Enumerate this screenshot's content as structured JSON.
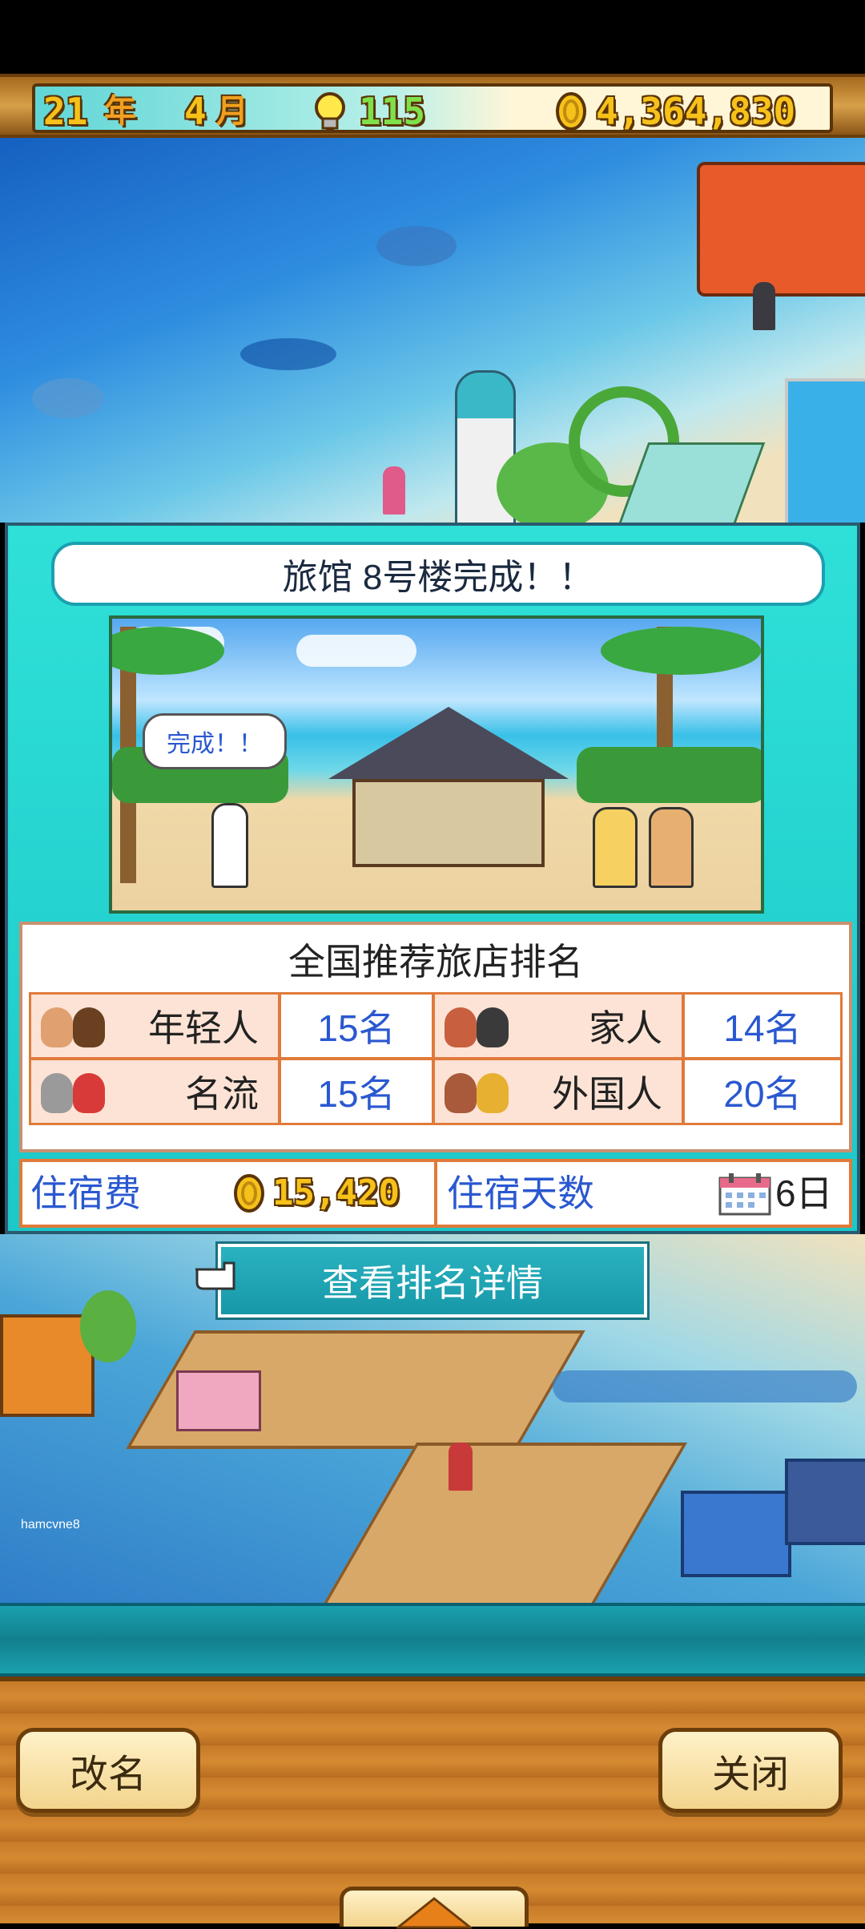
{
  "hud": {
    "year": "21",
    "year_unit": "年",
    "month": "4",
    "month_unit": "月",
    "ideas": "115",
    "money": "4,364,830"
  },
  "world": {
    "watermark": "hamcvne8"
  },
  "dialog": {
    "title": "旅馆 8号楼完成！！",
    "speech_bubble": "完成！！",
    "ranking": {
      "title": "全国推荐旅店排名",
      "rows": [
        {
          "label": "年轻人",
          "value": "15名"
        },
        {
          "label": "家人",
          "value": "14名"
        },
        {
          "label": "名流",
          "value": "15名"
        },
        {
          "label": "外国人",
          "value": "20名"
        }
      ]
    },
    "fee_label": "住宿费",
    "fee_value": "15,420",
    "days_label": "住宿天数",
    "days_value": "6日"
  },
  "details_button": "查看排名详情",
  "bottom": {
    "rename_button": "改名",
    "close_button": "关闭"
  }
}
